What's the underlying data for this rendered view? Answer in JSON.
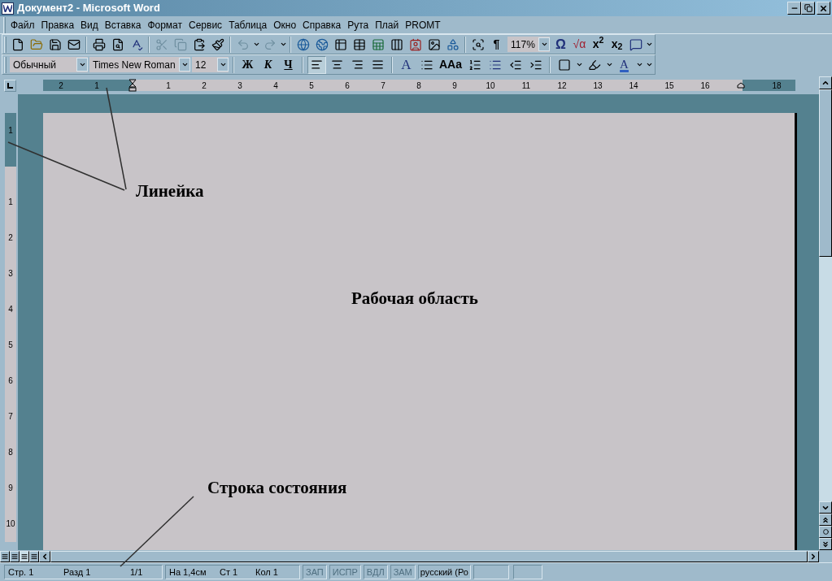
{
  "window": {
    "title": "Документ2 - Microsoft Word"
  },
  "menu": [
    "Файл",
    "Правка",
    "Вид",
    "Вставка",
    "Формат",
    "Сервис",
    "Таблица",
    "Окно",
    "Справка",
    "Рута",
    "Плай",
    "PROMT"
  ],
  "standard_toolbar": {
    "show_marks": "¶",
    "zoom": "117%",
    "symbol": "Ω",
    "equation": "√α",
    "superscript": "x$^{2}$",
    "subscript": "x$_{2}$"
  },
  "formatting_toolbar": {
    "style": "Обычный",
    "font": "Times New Roman",
    "size": "12",
    "format_buttons": [
      {
        "label": "Ж",
        "kind": "bold"
      },
      {
        "label": "К",
        "kind": "italic"
      },
      {
        "label": "Ч",
        "kind": "underline"
      }
    ],
    "alignment": [
      {
        "selected": true
      },
      {
        "selected": false
      },
      {
        "selected": false
      },
      {
        "selected": false
      }
    ],
    "style_letter": "A",
    "case_label": "AAa",
    "font_color_letter": "A"
  },
  "horizontal_ruler": {
    "left_labels": [
      "2",
      "1"
    ],
    "labels": [
      "1",
      "2",
      "3",
      "4",
      "5",
      "6",
      "7",
      "8",
      "9",
      "10",
      "11",
      "12",
      "13",
      "14",
      "15",
      "16"
    ],
    "end_labels": [
      "18"
    ]
  },
  "vertical_ruler": {
    "top_labels": [
      "1"
    ],
    "labels": [
      "1",
      "2",
      "3",
      "4",
      "5",
      "6",
      "7",
      "8",
      "9",
      "10"
    ]
  },
  "annotations": [
    {
      "text": "Линейка"
    },
    {
      "text": "Рабочая область"
    },
    {
      "text": "Строка состояния"
    }
  ],
  "status_bar": {
    "page": "Стр. 1",
    "section": "Разд 1",
    "pages": "1/1",
    "position": "На 1,4см",
    "line": "Ст 1",
    "column": "Кол 1",
    "indicators": [
      {
        "label": "ЗАП",
        "disabled": true
      },
      {
        "label": "ИСПР",
        "disabled": true
      },
      {
        "label": "ВДЛ",
        "disabled": true
      },
      {
        "label": "ЗАМ",
        "disabled": true
      }
    ],
    "language": "русский (Ро"
  }
}
